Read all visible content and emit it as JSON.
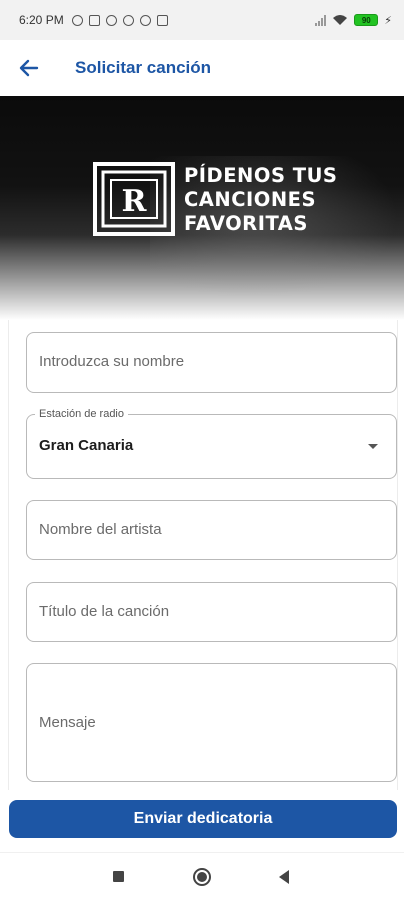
{
  "status_bar": {
    "time": "6:20 PM",
    "battery": "90",
    "icons": [
      "alarm-icon",
      "mail-icon",
      "sync-icon",
      "record-icon",
      "sync-icon",
      "laptop-icon",
      "signal-icon",
      "wifi-icon",
      "battery-icon",
      "charging-icon"
    ]
  },
  "app_bar": {
    "title": "Solicitar canción",
    "back_icon": "arrow-left-icon"
  },
  "banner": {
    "logo_letter": "R",
    "line1": "PÍDENOS TUS",
    "line2": "CANCIONES",
    "line3": "FAVORITAS"
  },
  "form": {
    "name_placeholder": "Introduzca su nombre",
    "station_label": "Estación de radio",
    "station_value": "Gran Canaria",
    "artist_placeholder": "Nombre del artista",
    "song_placeholder": "Título de la canción",
    "message_placeholder": "Mensaje"
  },
  "submit": {
    "label": "Enviar dedicatoria"
  },
  "colors": {
    "accent": "#1d56a5",
    "battery": "#22c322"
  }
}
